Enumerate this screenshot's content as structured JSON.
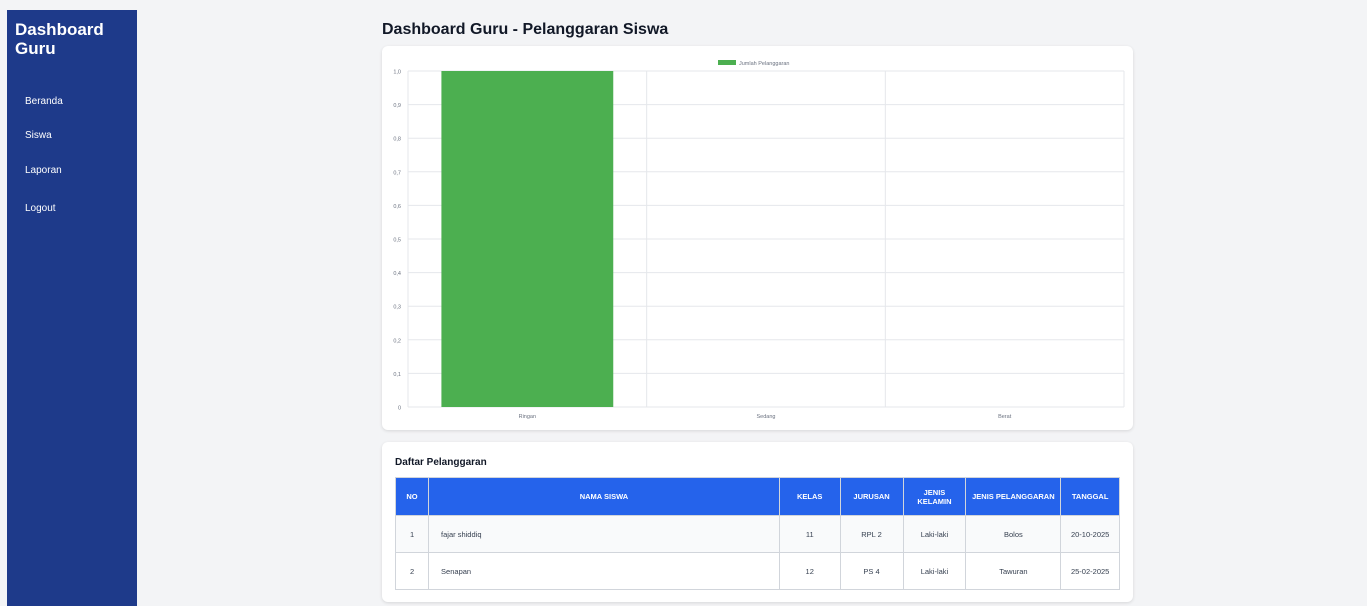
{
  "sidebar": {
    "brand": "Dashboard Guru",
    "items": [
      {
        "label": "Beranda"
      },
      {
        "label": "Siswa"
      },
      {
        "label": "Laporan"
      },
      {
        "label": "Logout"
      }
    ]
  },
  "page": {
    "title": "Dashboard Guru - Pelanggaran Siswa"
  },
  "chart_data": {
    "type": "bar",
    "categories": [
      "Ringan",
      "Sedang",
      "Berat"
    ],
    "series": [
      {
        "name": "Jumlah Pelanggaran",
        "values": [
          1,
          0,
          0
        ],
        "color": "#4caf50"
      }
    ],
    "ylim": [
      0,
      1
    ],
    "yticks": [
      "0",
      "0,1",
      "0,2",
      "0,3",
      "0,4",
      "0,5",
      "0,6",
      "0,7",
      "0,8",
      "0,9",
      "1,0"
    ],
    "legend_position": "top",
    "grid": true
  },
  "table": {
    "title": "Daftar Pelanggaran",
    "columns": [
      "NO",
      "NAMA SISWA",
      "KELAS",
      "JURUSAN",
      "JENIS KELAMIN",
      "JENIS PELANGGARAN",
      "TANGGAL"
    ],
    "rows": [
      [
        "1",
        "fajar shiddiq",
        "11",
        "RPL 2",
        "Laki-laki",
        "Bolos",
        "20-10-2025"
      ],
      [
        "2",
        "Senapan",
        "12",
        "PS 4",
        "Laki-laki",
        "Tawuran",
        "25-02-2025"
      ]
    ]
  },
  "colors": {
    "sidebar": "#1e3a8a",
    "header": "#2563eb",
    "bar": "#4caf50"
  }
}
